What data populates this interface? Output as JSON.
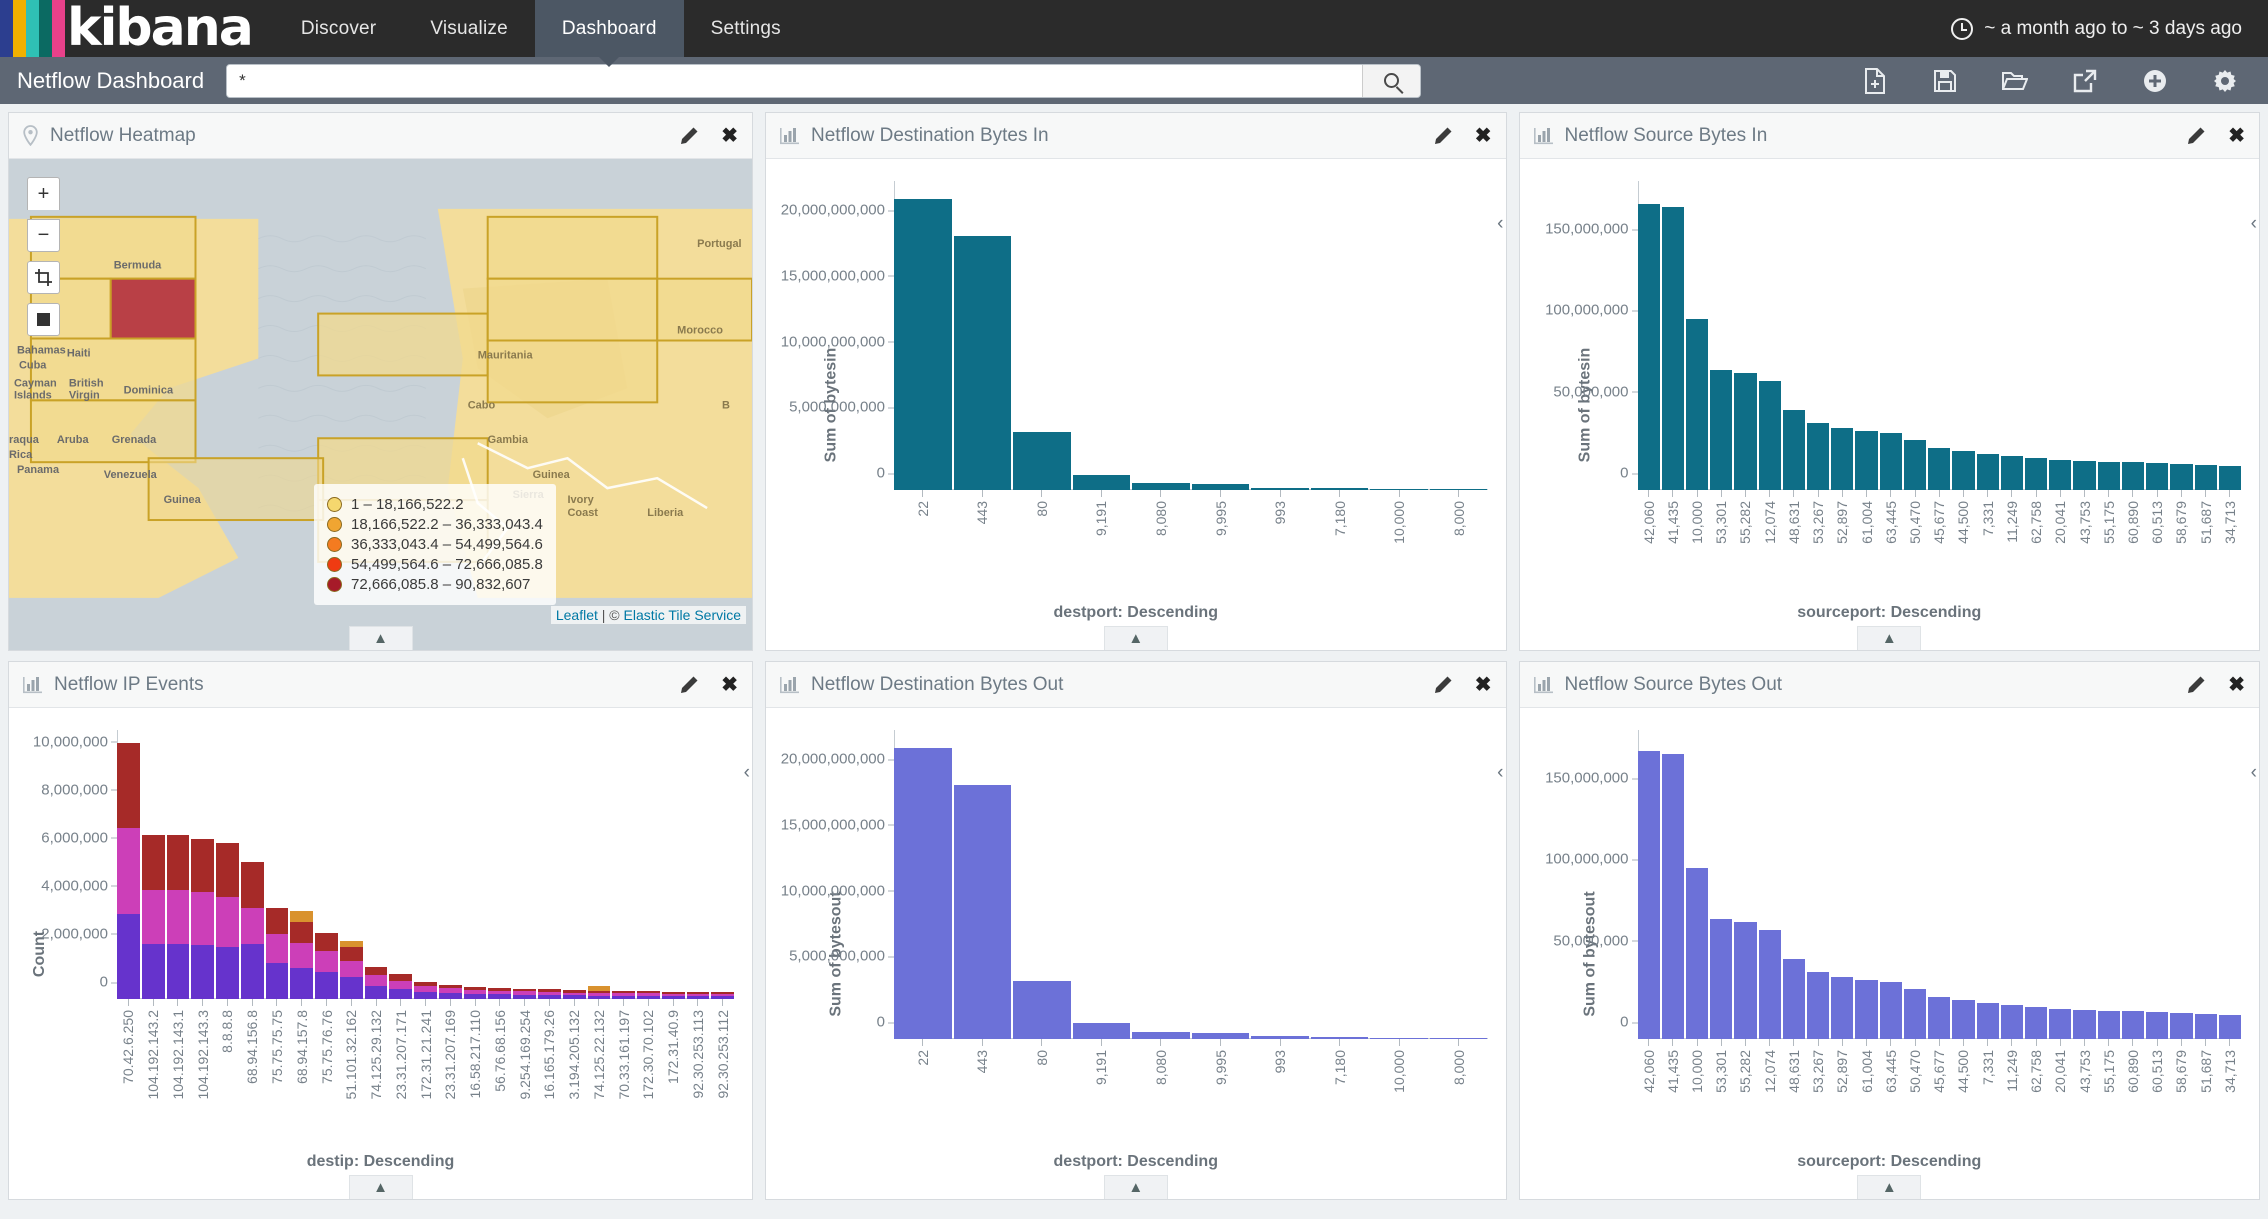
{
  "app": {
    "brand": "kibana",
    "logo_colors": [
      "#2c3e8f",
      "#f0b000",
      "#2fc0b5",
      "#0b6a62",
      "#e8418a"
    ],
    "nav": [
      {
        "label": "Discover",
        "active": false
      },
      {
        "label": "Visualize",
        "active": false
      },
      {
        "label": "Dashboard",
        "active": true
      },
      {
        "label": "Settings",
        "active": false
      }
    ],
    "time_range": "~ a month ago to ~ 3 days ago",
    "time_icon": "clock-icon"
  },
  "subbar": {
    "dashboard_title": "Netflow Dashboard",
    "query_value": "*",
    "query_placeholder": "*",
    "search_icon": "search-icon",
    "tools": [
      {
        "name": "new-dashboard-icon",
        "label": "New"
      },
      {
        "name": "save-icon",
        "label": "Save"
      },
      {
        "name": "open-folder-icon",
        "label": "Open"
      },
      {
        "name": "share-icon",
        "label": "Share"
      },
      {
        "name": "add-panel-icon",
        "label": "Add"
      },
      {
        "name": "gear-icon",
        "label": "Options"
      }
    ]
  },
  "panels": [
    {
      "title": "Netflow Heatmap",
      "icon": "map-marker-icon"
    },
    {
      "title": "Netflow Destination Bytes In",
      "icon": "bar-chart-icon"
    },
    {
      "title": "Netflow Source Bytes In",
      "icon": "bar-chart-icon"
    },
    {
      "title": "Netflow IP Events",
      "icon": "bar-chart-icon"
    },
    {
      "title": "Netflow Destination Bytes Out",
      "icon": "bar-chart-icon"
    },
    {
      "title": "Netflow Source Bytes Out",
      "icon": "bar-chart-icon"
    }
  ],
  "map": {
    "controls": [
      "+",
      "−",
      "crop-icon",
      "square-icon"
    ],
    "legend_title": "",
    "legend": [
      {
        "range": "1 – 18,166,522.2",
        "color": "#f5d76e"
      },
      {
        "range": "18,166,522.2 – 36,333,043.4",
        "color": "#f0a532"
      },
      {
        "range": "36,333,043.4 – 54,499,564.6",
        "color": "#f47b20"
      },
      {
        "range": "54,499,564.6 – 72,666,085.8",
        "color": "#ef3b12"
      },
      {
        "range": "72,666,085.8 – 90,832,607",
        "color": "#a61b29"
      }
    ],
    "attribution_prefix": "Leaflet | © ",
    "attribution_link": "Elastic Tile Service",
    "place_labels": [
      "Portugal",
      "Morocco",
      "Bermuda",
      "Bahamas",
      "Cuba",
      "Haiti",
      "Cayman Islands",
      "British Virgin",
      "Dominica",
      "Aruba",
      "Grenada",
      "Venezuela",
      "Panama",
      "Costa Rica",
      "Mauritania",
      "Guinea",
      "Sierra",
      "Ivory Coast",
      "Liberia",
      "Cabo",
      "Gambia",
      "B"
    ]
  },
  "chart_data": [
    {
      "id": "destination-bytes-in",
      "type": "bar",
      "title": "Netflow Destination Bytes In",
      "xlabel": "destport: Descending",
      "ylabel": "Sum of bytesin",
      "color": "#0e6e87",
      "ylim": [
        0,
        23500000000
      ],
      "yticks": [
        0,
        5000000000,
        10000000000,
        15000000000,
        20000000000
      ],
      "ytick_labels": [
        "0",
        "5,000,000,000",
        "10,000,000,000",
        "15,000,000,000",
        "20,000,000,000"
      ],
      "categories": [
        "22",
        "443",
        "80",
        "9,191",
        "8,080",
        "9,995",
        "993",
        "7,180",
        "10,000",
        "8,000"
      ],
      "values": [
        22100000000,
        19350000000,
        4450000000,
        1120000000,
        510000000,
        440000000,
        190000000,
        120000000,
        95000000,
        70000000
      ]
    },
    {
      "id": "source-bytes-in",
      "type": "bar",
      "title": "Netflow Source Bytes In",
      "xlabel": "sourceport: Descending",
      "ylabel": "Sum of bytesin",
      "color": "#0e6e87",
      "ylim": [
        0,
        190000000
      ],
      "yticks": [
        0,
        50000000,
        100000000,
        150000000
      ],
      "ytick_labels": [
        "0",
        "50,000,000",
        "100,000,000",
        "150,000,000"
      ],
      "categories": [
        "42,060",
        "41,435",
        "10,000",
        "53,301",
        "55,282",
        "12,074",
        "48,631",
        "53,267",
        "52,897",
        "61,004",
        "63,445",
        "50,470",
        "45,677",
        "44,500",
        "7,331",
        "11,249",
        "62,758",
        "20,041",
        "43,753",
        "55,175",
        "60,890",
        "60,513",
        "58,679",
        "51,687",
        "34,713"
      ],
      "values": [
        176000000,
        174000000,
        105000000,
        74000000,
        72000000,
        67000000,
        49000000,
        41000000,
        38000000,
        36000000,
        35000000,
        31000000,
        26000000,
        24000000,
        22000000,
        21000000,
        19500000,
        18500000,
        18000000,
        17500000,
        17000000,
        16500000,
        16000000,
        15500000,
        15000000
      ]
    },
    {
      "id": "destination-bytes-out",
      "type": "bar",
      "title": "Netflow Destination Bytes Out",
      "xlabel": "destport: Descending",
      "ylabel": "Sum of bytesout",
      "color": "#6c71d8",
      "ylim": [
        0,
        23500000000
      ],
      "yticks": [
        0,
        5000000000,
        10000000000,
        15000000000,
        20000000000
      ],
      "ytick_labels": [
        "0",
        "5,000,000,000",
        "10,000,000,000",
        "15,000,000,000",
        "20,000,000,000"
      ],
      "categories": [
        "22",
        "443",
        "80",
        "9,191",
        "8,080",
        "9,995",
        "993",
        "7,180",
        "10,000",
        "8,000"
      ],
      "values": [
        22100000000,
        19300000000,
        4420000000,
        1180000000,
        520000000,
        440000000,
        195000000,
        120000000,
        95000000,
        70000000
      ]
    },
    {
      "id": "source-bytes-out",
      "type": "bar",
      "title": "Netflow Source Bytes Out",
      "xlabel": "sourceport: Descending",
      "ylabel": "Sum of bytesout",
      "color": "#6c71d8",
      "ylim": [
        0,
        190000000
      ],
      "yticks": [
        0,
        50000000,
        100000000,
        150000000
      ],
      "ytick_labels": [
        "0",
        "50,000,000",
        "100,000,000",
        "150,000,000"
      ],
      "categories": [
        "42,060",
        "41,435",
        "10,000",
        "53,301",
        "55,282",
        "12,074",
        "48,631",
        "53,267",
        "52,897",
        "61,004",
        "63,445",
        "50,470",
        "45,677",
        "44,500",
        "7,331",
        "11,249",
        "62,758",
        "20,041",
        "43,753",
        "55,175",
        "60,890",
        "60,513",
        "58,679",
        "51,687",
        "34,713"
      ],
      "values": [
        177000000,
        175000000,
        105000000,
        74000000,
        72000000,
        67000000,
        49000000,
        41000000,
        38000000,
        36000000,
        35000000,
        31000000,
        26000000,
        24000000,
        22000000,
        21000000,
        19500000,
        18500000,
        18000000,
        17500000,
        17000000,
        16500000,
        16000000,
        15500000,
        15000000
      ]
    },
    {
      "id": "ip-events",
      "type": "bar",
      "stacked": true,
      "title": "Netflow IP Events",
      "xlabel": "destip: Descending",
      "ylabel": "Count",
      "ylim": [
        0,
        11200000
      ],
      "yticks": [
        0,
        2000000,
        4000000,
        6000000,
        8000000,
        10000000
      ],
      "ytick_labels": [
        "0",
        "2,000,000",
        "4,000,000",
        "6,000,000",
        "8,000,000",
        "10,000,000"
      ],
      "series_colors": [
        "#6633cc",
        "#c council",
        "#cc44bb",
        "#a62a28",
        "#d9922e"
      ],
      "categories": [
        "70.42.6.250",
        "104.192.143.2",
        "104.192.143.1",
        "104.192.143.3",
        "8.8.8.8",
        "68.94.156.8",
        "75.75.75.75",
        "68.94.157.8",
        "75.75.76.76",
        "51.101.32.162",
        "74.125.29.132",
        "23.31.207.171",
        "172.31.21.241",
        "23.31.207.169",
        "16.58.217.110",
        "56.76.68.156",
        "9.254.169.254",
        "16.165.179.26",
        "3.194.205.132",
        "74.125.22.132",
        "70.33.161.197",
        "172.30.70.102",
        "172.31.40.9",
        "92.30.253.113",
        "92.30.253.112"
      ],
      "series": [
        {
          "name": "purple",
          "color": "#6633cc",
          "values": [
            3560000,
            2270000,
            2270000,
            2240000,
            2160000,
            2300000,
            1520000,
            1290000,
            1130000,
            900000,
            560000,
            430000,
            300000,
            250000,
            210000,
            190000,
            175000,
            160000,
            150000,
            140000,
            135000,
            130000,
            125000,
            120000,
            118000
          ]
        },
        {
          "name": "magenta",
          "color": "#cc3fb8",
          "values": [
            3550000,
            2270000,
            2270000,
            2230000,
            2090000,
            1500000,
            1200000,
            1050000,
            880000,
            700000,
            430000,
            330000,
            230000,
            190000,
            160000,
            150000,
            140000,
            130000,
            120000,
            115000,
            110000,
            105000,
            100000,
            98000,
            95000
          ]
        },
        {
          "name": "dark-red",
          "color": "#a62a28",
          "values": [
            3540000,
            2300000,
            2280000,
            2190000,
            2240000,
            1890000,
            1080000,
            880000,
            720000,
            560000,
            340000,
            280000,
            190000,
            160000,
            140000,
            130000,
            120000,
            112000,
            105000,
            100000,
            96000,
            92000,
            88000,
            85000,
            82000
          ]
        },
        {
          "name": "orange",
          "color": "#d9922e",
          "values": [
            0,
            0,
            0,
            0,
            0,
            0,
            0,
            430000,
            0,
            250000,
            0,
            0,
            0,
            0,
            0,
            0,
            0,
            0,
            0,
            190000,
            0,
            0,
            0,
            0,
            0
          ]
        }
      ]
    }
  ],
  "panel_controls": {
    "edit_icon": "pencil-icon",
    "close_icon": "close-icon",
    "collapse_icon": "chevron-up-icon",
    "expand_icon": "chevron-left-icon"
  }
}
